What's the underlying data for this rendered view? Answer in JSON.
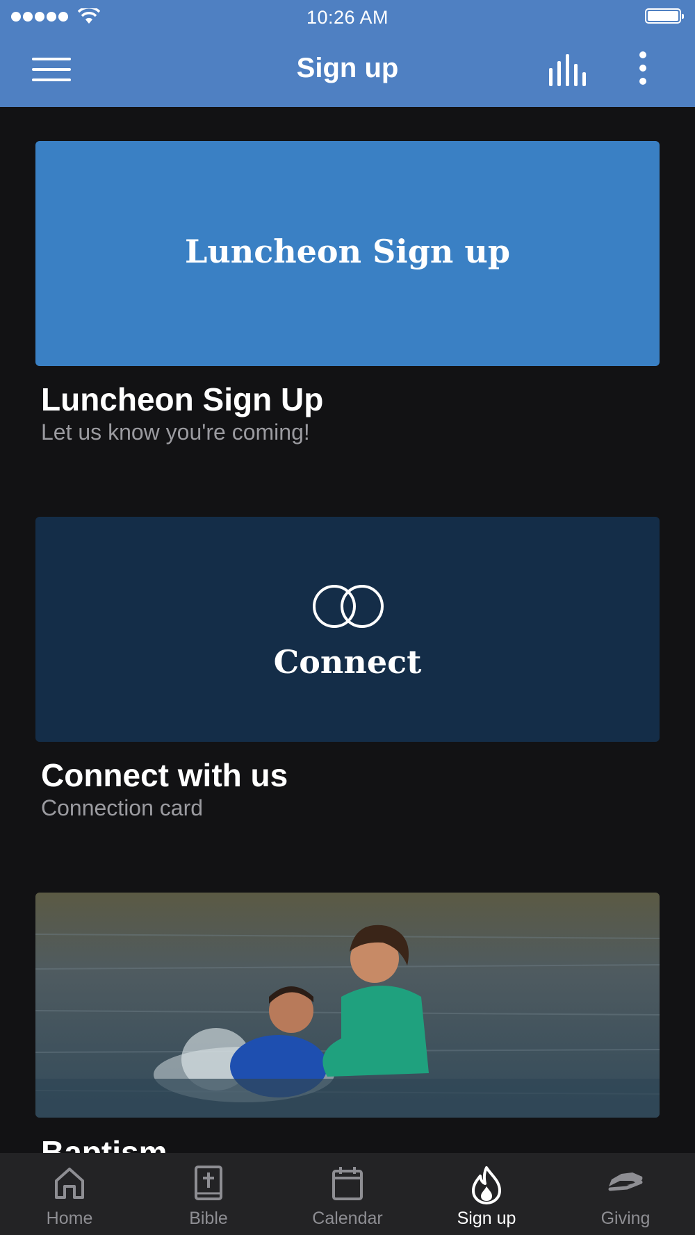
{
  "status_bar": {
    "time": "10:26 AM"
  },
  "header": {
    "title": "Sign up"
  },
  "cards": [
    {
      "banner_text": "Luncheon Sign up",
      "title": "Luncheon Sign Up",
      "subtitle": "Let us know you're coming!",
      "banner_color": "#3a80c4"
    },
    {
      "banner_text": "Connect",
      "title": "Connect with us",
      "subtitle": "Connection card",
      "banner_color": "#142d48"
    },
    {
      "title": "Baptism"
    }
  ],
  "tabs": [
    {
      "label": "Home",
      "icon": "home-icon"
    },
    {
      "label": "Bible",
      "icon": "bible-icon"
    },
    {
      "label": "Calendar",
      "icon": "calendar-icon"
    },
    {
      "label": "Sign up",
      "icon": "flame-icon",
      "active": true
    },
    {
      "label": "Giving",
      "icon": "giving-hand-icon"
    }
  ],
  "colors": {
    "header": "#4f80c2",
    "background": "#121214",
    "tabbar": "#232325"
  }
}
